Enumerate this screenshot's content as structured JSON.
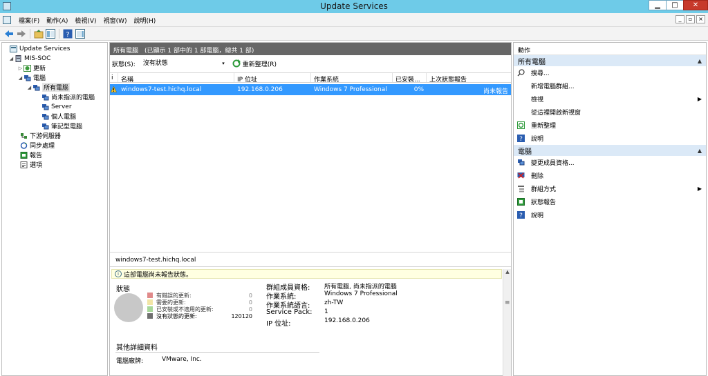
{
  "window": {
    "title": "Update Services"
  },
  "menu": [
    "檔案(F)",
    "動作(A)",
    "檢視(V)",
    "視窗(W)",
    "說明(H)"
  ],
  "window_controls": {
    "min": "▁",
    "max": "□",
    "close": "✕"
  },
  "mdi_controls": [
    "_",
    "▫",
    "×"
  ],
  "tree": [
    {
      "label": "Update Services",
      "level": 0,
      "twisty": "",
      "icon": "update-services-icon"
    },
    {
      "label": "MIS-SOC",
      "level": 1,
      "twisty": "◢",
      "icon": "server-icon"
    },
    {
      "label": "更新",
      "level": 2,
      "twisty": "▷",
      "icon": "updates-icon"
    },
    {
      "label": "電腦",
      "level": 2,
      "twisty": "◢",
      "icon": "computers-icon"
    },
    {
      "label": "所有電腦",
      "level": 3,
      "twisty": "◢",
      "icon": "computer-group-icon",
      "selected": true
    },
    {
      "label": "尚未指派的電腦",
      "level": 4,
      "twisty": "",
      "icon": "computer-group-icon"
    },
    {
      "label": "Server",
      "level": 4,
      "twisty": "",
      "icon": "computer-group-icon"
    },
    {
      "label": "個人電腦",
      "level": 4,
      "twisty": "",
      "icon": "computer-group-icon"
    },
    {
      "label": "筆記型電腦",
      "level": 4,
      "twisty": "",
      "icon": "computer-group-icon"
    },
    {
      "label": "下游伺服器",
      "level": 2,
      "twisty": "",
      "icon": "downstream-servers-icon"
    },
    {
      "label": "同步處理",
      "level": 2,
      "twisty": "",
      "icon": "synchronization-icon"
    },
    {
      "label": "報告",
      "level": 2,
      "twisty": "",
      "icon": "reports-icon"
    },
    {
      "label": "選項",
      "level": 2,
      "twisty": "",
      "icon": "options-icon"
    }
  ],
  "main": {
    "header": "所有電腦　(已顯示 1 部中的 1 部電腦，總共 1 部)",
    "filter_label": "狀態(S):",
    "filter_value": "沒有狀態",
    "filter_arrow": "▾",
    "refresh_label": "重新整理(R)",
    "columns": [
      "i",
      "名稱",
      "IP 位址",
      "作業系統",
      "已安裝...",
      "上次狀態報告"
    ],
    "rows": [
      {
        "name": "windows7-test.hichq.local",
        "ip": "192.168.0.206",
        "os": "Windows 7 Professional",
        "installed": "0%",
        "last_report": "尚未報告"
      }
    ],
    "detail_title": "windows7-test.hichq.local",
    "info_message": "這部電腦尚未報告狀態。",
    "info_icon": "i",
    "status_title": "狀態",
    "legend": [
      {
        "label": "有錯誤的更新:",
        "count": "0",
        "color": "#e08a8a"
      },
      {
        "label": "需要的更新:",
        "count": "0",
        "color": "#f2e6a6"
      },
      {
        "label": "已安裝或不適用的更新:",
        "count": "0",
        "color": "#a8d89a"
      },
      {
        "label": "沒有狀態的更新:",
        "count": "120120",
        "color": "#707070"
      }
    ],
    "properties": [
      {
        "key": "群組成員資格:",
        "value": "所有電腦, 尚未指派的電腦"
      },
      {
        "key": "作業系統:",
        "value": "Windows 7 Professional"
      },
      {
        "key": "作業系統語言:",
        "value": "zh-TW"
      },
      {
        "key": "Service Pack:",
        "value": "1"
      },
      {
        "key": "IP 位址:",
        "value": "192.168.0.206"
      }
    ],
    "other_title": "其他詳細資料",
    "other": {
      "key": "電腦廠牌:",
      "value": "VMware, Inc."
    }
  },
  "actions": {
    "header": "動作",
    "sections": [
      {
        "title": "所有電腦",
        "caret": "▲",
        "items": [
          {
            "label": "搜尋...",
            "icon": "search-icon",
            "submenu": false
          },
          {
            "label": "新增電腦群組...",
            "icon": "",
            "submenu": false
          },
          {
            "label": "檢視",
            "icon": "",
            "submenu": true
          },
          {
            "label": "從這裡開啟新視窗",
            "icon": "",
            "submenu": false
          },
          {
            "label": "重新整理",
            "icon": "refresh-icon",
            "submenu": false
          },
          {
            "label": "說明",
            "icon": "help-icon",
            "submenu": false
          }
        ]
      },
      {
        "title": "電腦",
        "caret": "▲",
        "items": [
          {
            "label": "變更成員資格...",
            "icon": "change-membership-icon",
            "submenu": false
          },
          {
            "label": "刪除",
            "icon": "delete-icon",
            "submenu": false
          },
          {
            "label": "群組方式",
            "icon": "group-by-icon",
            "submenu": true
          },
          {
            "label": "狀態報告",
            "icon": "status-report-icon",
            "submenu": false
          },
          {
            "label": "說明",
            "icon": "help-icon",
            "submenu": false
          }
        ]
      }
    ],
    "submenu_arrow": "▶"
  },
  "colors": {
    "titlebar": "#6ecbe8",
    "selection": "#3399ff",
    "pane_header": "#666666",
    "section_header": "#dbe9f7",
    "info_bar": "#ffffe1"
  }
}
